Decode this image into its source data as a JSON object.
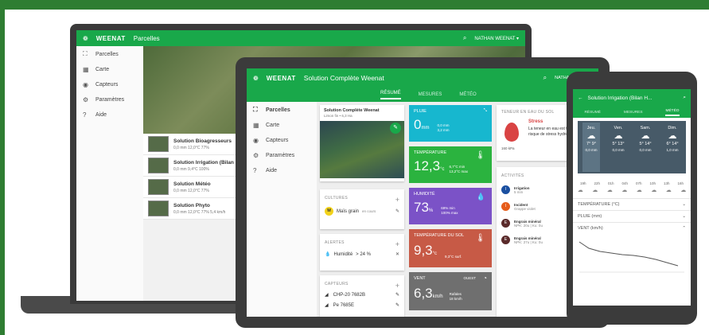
{
  "colors": {
    "brand": "#19a84a",
    "rain": "#17b7cf",
    "temp": "#2bb33f",
    "humidity": "#7b52c7",
    "soil": "#c75a46",
    "wind": "#6f6f6f",
    "weather": "#475a68"
  },
  "laptop": {
    "brand": "WEENAT",
    "title": "Parcelles",
    "user": "NATHAN WEENAT ▾",
    "nav": [
      {
        "icon": "⛶",
        "label": "Parcelles"
      },
      {
        "icon": "▦",
        "label": "Carte"
      },
      {
        "icon": "◉",
        "label": "Capteurs"
      },
      {
        "icon": "⚙",
        "label": "Paramètres"
      },
      {
        "icon": "?",
        "label": "Aide"
      }
    ],
    "rows": [
      {
        "title": "Solution Bioagresseurs",
        "stats": "0,0 mm   12,0°C   77%"
      },
      {
        "title": "Solution Irrigation (Bilan hydri",
        "stats": "0,0 mm   9,4°C   100%"
      },
      {
        "title": "Solution Météo",
        "stats": "0,0 mm   12,0°C   77%"
      },
      {
        "title": "Solution Phyto",
        "stats": "0,0 mm   12,0°C   77%   5,4 km/h"
      }
    ]
  },
  "tablet": {
    "brand": "WEENAT",
    "title": "Solution Complète Weenat",
    "user": "NATHAN WEENAT",
    "tabs": [
      "RÉSUMÉ",
      "MESURES",
      "MÉTÉO"
    ],
    "nav": [
      {
        "icon": "⛶",
        "label": "Parcelles"
      },
      {
        "icon": "▦",
        "label": "Carte"
      },
      {
        "icon": "◉",
        "label": "Capteurs"
      },
      {
        "icon": "⚙",
        "label": "Paramètres"
      },
      {
        "icon": "?",
        "label": "Aide"
      }
    ],
    "parcel": {
      "title": "Solution Complète Weenat",
      "sub": "Limon fin • 6,3 Ha"
    },
    "cultures": {
      "header": "CULTURES",
      "badge": "M",
      "name": "Maïs grain",
      "state": "en cours"
    },
    "alertes": {
      "header": "ALERTES",
      "label": "Humidité",
      "value": "> 24 %"
    },
    "capteurs": {
      "header": "CAPTEURS",
      "items": [
        "CHP-20 7682B",
        "Pe 7685E"
      ]
    },
    "tiles": {
      "pluie": {
        "label": "PLUIE",
        "value": "0",
        "unit": "mm",
        "s1": "0,0 mm",
        "s2": "3,2 mm"
      },
      "temp": {
        "label": "TEMPÉRATURE",
        "value": "12,3",
        "unit": "°c",
        "s1": "6,7°C min",
        "s2": "13,2°C max"
      },
      "hum": {
        "label": "HUMIDITÉ",
        "value": "73",
        "unit": "%",
        "s1": "69% min",
        "s2": "100% max"
      },
      "soil": {
        "label": "TEMPÉRATURE DU SOL",
        "value": "9,3",
        "unit": "°c",
        "s1": "9,3°C surf."
      },
      "vent": {
        "label": "VENT",
        "value": "6,3",
        "unit": "km/h",
        "dir": "OUEST",
        "s1": "Rafales",
        "s2": "18 km/h"
      }
    },
    "water": {
      "header": "TENEUR EN EAU DU SOL",
      "value": "160 kPa",
      "title": "Stress",
      "text": "La teneur en eau est très faible, risque de stress hydrique."
    },
    "activities": {
      "header": "ACTIVITÉS",
      "items": [
        {
          "badge": "I",
          "color": "#1a4fa0",
          "title": "Irrigation",
          "sub": "5 mm",
          "date": "22 févr."
        },
        {
          "badge": "I",
          "color": "#e65c1a",
          "title": "Incident",
          "sub": "Grappe violet",
          "date": "10 févr."
        },
        {
          "badge": "E",
          "color": "#5a2a2a",
          "title": "Engrais minéral",
          "sub": "NPK: 20u | Ku: 0u",
          "date": "8 févr."
        },
        {
          "badge": "E",
          "color": "#5a2a2a",
          "title": "Engrais minéral",
          "sub": "NPK: 27u | Ku: 0u",
          "date": "1 févr."
        }
      ]
    }
  },
  "phone": {
    "title": "Solution Irrigation (Bilan H...",
    "tabs": [
      "RÉSUMÉ",
      "MESURES",
      "MÉTÉO"
    ],
    "days": [
      {
        "name": "Jeu.",
        "temps": "7° 9°",
        "rain": "0,0 mm"
      },
      {
        "name": "Ven.",
        "temps": "5° 13°",
        "rain": "0,0 mm"
      },
      {
        "name": "Sam.",
        "temps": "5° 14°",
        "rain": "0,0 mm"
      },
      {
        "name": "Dim.",
        "temps": "6° 14°",
        "rain": "1,0 mm"
      }
    ],
    "hours": [
      "19h",
      "22h",
      "01h",
      "04h",
      "07h",
      "10h",
      "13h",
      "16h"
    ],
    "sections": [
      "TEMPÉRATURE (°C)",
      "PLUIE (mm)",
      "VENT (km/h)"
    ]
  }
}
